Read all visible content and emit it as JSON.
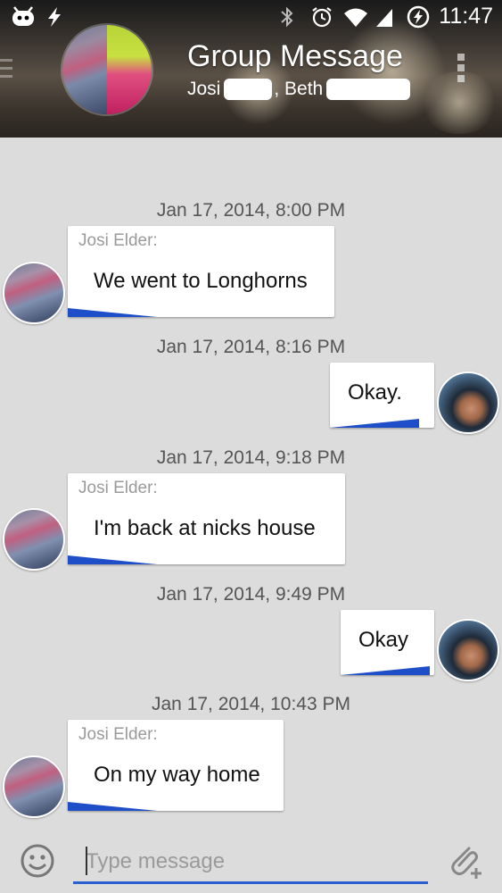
{
  "status": {
    "time": "11:47"
  },
  "header": {
    "title": "Group Message",
    "members": [
      "Josi",
      "Beth"
    ]
  },
  "messages": [
    {
      "timestamp": "Jan 17, 2014, 8:00 PM",
      "sender": "Josi Elder:",
      "text": "We went to Longhorns",
      "direction": "incoming"
    },
    {
      "timestamp": "Jan 17, 2014, 8:16 PM",
      "sender": "",
      "text": "Okay.",
      "direction": "outgoing"
    },
    {
      "timestamp": "Jan 17, 2014, 9:18 PM",
      "sender": "Josi Elder:",
      "text": "I'm back at nicks house",
      "direction": "incoming"
    },
    {
      "timestamp": "Jan 17, 2014, 9:49 PM",
      "sender": "",
      "text": "Okay",
      "direction": "outgoing"
    },
    {
      "timestamp": "Jan 17, 2014, 10:43 PM",
      "sender": "Josi Elder:",
      "text": "On my way home",
      "direction": "incoming"
    }
  ],
  "composer": {
    "placeholder": "Type message"
  },
  "colors": {
    "accent": "#1f4fc8",
    "background": "#dcdcdc",
    "timestamp": "#555555"
  },
  "icons": {
    "emoji": "smiley-icon",
    "attach": "paperclip-plus-icon",
    "overflow": "overflow-menu-icon"
  }
}
